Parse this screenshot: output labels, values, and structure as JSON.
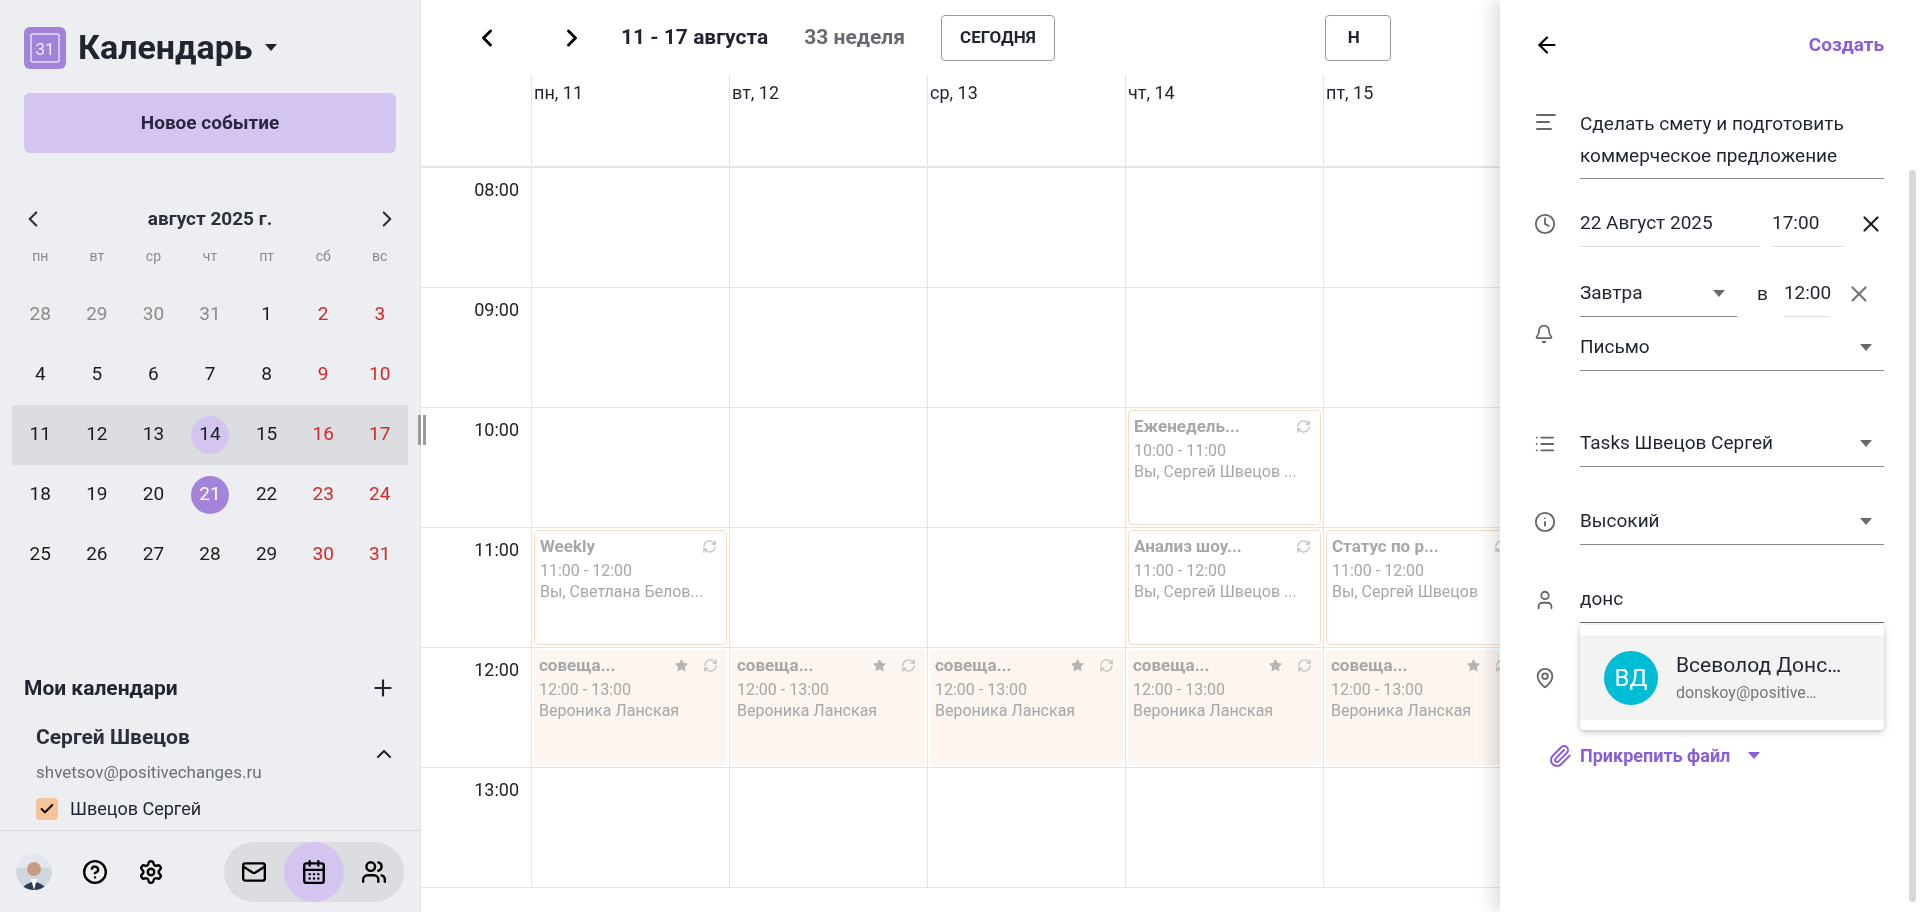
{
  "sidebar": {
    "logo_text": "31",
    "app_title": "Календарь",
    "new_event_button": "Новое событие",
    "mini_calendar": {
      "month": "август 2025 г.",
      "weekdays": [
        "пн",
        "вт",
        "ср",
        "чт",
        "пт",
        "сб",
        "вс"
      ],
      "weeks": [
        {
          "selected": false,
          "days": [
            {
              "label": "28",
              "kind": "outside",
              "today": false,
              "selected": false
            },
            {
              "label": "29",
              "kind": "outside",
              "today": false,
              "selected": false
            },
            {
              "label": "30",
              "kind": "outside",
              "today": false,
              "selected": false
            },
            {
              "label": "31",
              "kind": "outside",
              "today": false,
              "selected": false
            },
            {
              "label": "1",
              "kind": "weekday",
              "today": false,
              "selected": false
            },
            {
              "label": "2",
              "kind": "weekend",
              "today": false,
              "selected": false
            },
            {
              "label": "3",
              "kind": "weekend",
              "today": false,
              "selected": false
            }
          ]
        },
        {
          "selected": false,
          "days": [
            {
              "label": "4",
              "kind": "weekday",
              "today": false,
              "selected": false
            },
            {
              "label": "5",
              "kind": "weekday",
              "today": false,
              "selected": false
            },
            {
              "label": "6",
              "kind": "weekday",
              "today": false,
              "selected": false
            },
            {
              "label": "7",
              "kind": "weekday",
              "today": false,
              "selected": false
            },
            {
              "label": "8",
              "kind": "weekday",
              "today": false,
              "selected": false
            },
            {
              "label": "9",
              "kind": "weekend",
              "today": false,
              "selected": false
            },
            {
              "label": "10",
              "kind": "weekend",
              "today": false,
              "selected": false
            }
          ]
        },
        {
          "selected": true,
          "days": [
            {
              "label": "11",
              "kind": "weekday",
              "today": false,
              "selected": false
            },
            {
              "label": "12",
              "kind": "weekday",
              "today": false,
              "selected": false
            },
            {
              "label": "13",
              "kind": "weekday",
              "today": false,
              "selected": false
            },
            {
              "label": "14",
              "kind": "weekday",
              "today": true,
              "selected": false
            },
            {
              "label": "15",
              "kind": "weekday",
              "today": false,
              "selected": false
            },
            {
              "label": "16",
              "kind": "weekend",
              "today": false,
              "selected": false
            },
            {
              "label": "17",
              "kind": "weekend",
              "today": false,
              "selected": false
            }
          ]
        },
        {
          "selected": false,
          "days": [
            {
              "label": "18",
              "kind": "weekday",
              "today": false,
              "selected": false
            },
            {
              "label": "19",
              "kind": "weekday",
              "today": false,
              "selected": false
            },
            {
              "label": "20",
              "kind": "weekday",
              "today": false,
              "selected": false
            },
            {
              "label": "21",
              "kind": "weekday",
              "today": false,
              "selected": true
            },
            {
              "label": "22",
              "kind": "weekday",
              "today": false,
              "selected": false
            },
            {
              "label": "23",
              "kind": "weekend",
              "today": false,
              "selected": false
            },
            {
              "label": "24",
              "kind": "weekend",
              "today": false,
              "selected": false
            }
          ]
        },
        {
          "selected": false,
          "days": [
            {
              "label": "25",
              "kind": "weekday",
              "today": false,
              "selected": false
            },
            {
              "label": "26",
              "kind": "weekday",
              "today": false,
              "selected": false
            },
            {
              "label": "27",
              "kind": "weekday",
              "today": false,
              "selected": false
            },
            {
              "label": "28",
              "kind": "weekday",
              "today": false,
              "selected": false
            },
            {
              "label": "29",
              "kind": "weekday",
              "today": false,
              "selected": false
            },
            {
              "label": "30",
              "kind": "weekend",
              "today": false,
              "selected": false
            },
            {
              "label": "31",
              "kind": "weekend",
              "today": false,
              "selected": false
            }
          ]
        }
      ]
    },
    "my_calendars": {
      "heading": "Мои календари",
      "accounts": [
        {
          "name": "Сергей Швецов",
          "email": "shvetsov@positivechanges.ru",
          "expanded": true,
          "calendars": [
            {
              "label": "Швецов Сергей",
              "checked": true,
              "color": "#f6c39b"
            }
          ]
        }
      ]
    },
    "bottom_nav": [
      {
        "kind": "mail",
        "selected": false
      },
      {
        "kind": "calendar",
        "selected": true
      },
      {
        "kind": "contacts",
        "selected": false
      }
    ]
  },
  "week_view": {
    "range": "11 - 17 августа",
    "week_number": "33 неделя",
    "today_button": "СЕГОДНЯ",
    "view_button": "Н",
    "days": [
      "пн, 11",
      "вт, 12",
      "ср, 13",
      "чт, 14",
      "пт, 15"
    ],
    "hours": [
      {
        "time": "08:00",
        "cells": [
          {
            "kind": "empty"
          },
          {
            "kind": "empty"
          },
          {
            "kind": "empty"
          },
          {
            "kind": "empty"
          },
          {
            "kind": "empty"
          }
        ]
      },
      {
        "time": "09:00",
        "cells": [
          {
            "kind": "empty"
          },
          {
            "kind": "empty"
          },
          {
            "kind": "empty"
          },
          {
            "kind": "empty"
          },
          {
            "kind": "empty"
          }
        ]
      },
      {
        "time": "10:00",
        "cells": [
          {
            "kind": "empty"
          },
          {
            "kind": "empty"
          },
          {
            "kind": "empty"
          },
          {
            "kind": "outlined",
            "title": "Еженедель...",
            "time": "10:00 - 11:00",
            "people": "Вы, Сергей Швецов ...",
            "starred": false,
            "recurring": true
          },
          {
            "kind": "empty"
          }
        ]
      },
      {
        "time": "11:00",
        "cells": [
          {
            "kind": "outlined",
            "title": "Weekly",
            "time": "11:00 - 12:00",
            "people": "Вы, Светлана Белов...",
            "starred": false,
            "recurring": true
          },
          {
            "kind": "empty"
          },
          {
            "kind": "empty"
          },
          {
            "kind": "outlined",
            "title": "Анализ шоу...",
            "time": "11:00 - 12:00",
            "people": "Вы, Сергей Швецов ...",
            "starred": false,
            "recurring": true
          },
          {
            "kind": "outlined",
            "title": "Статус по р...",
            "time": "11:00 - 12:00",
            "people": "Вы, Сергей Швецов",
            "starred": false,
            "recurring": true
          }
        ]
      },
      {
        "time": "12:00",
        "cells": [
          {
            "kind": "filled",
            "title": "совеща...",
            "time": "12:00 - 13:00",
            "people": "Вероника Ланская",
            "starred": true,
            "recurring": true
          },
          {
            "kind": "filled",
            "title": "совеща...",
            "time": "12:00 - 13:00",
            "people": "Вероника Ланская",
            "starred": true,
            "recurring": true
          },
          {
            "kind": "filled",
            "title": "совеща...",
            "time": "12:00 - 13:00",
            "people": "Вероника Ланская",
            "starred": true,
            "recurring": true
          },
          {
            "kind": "filled",
            "title": "совеща...",
            "time": "12:00 - 13:00",
            "people": "Вероника Ланская",
            "starred": true,
            "recurring": true
          },
          {
            "kind": "filled",
            "title": "совеща...",
            "time": "12:00 - 13:00",
            "people": "Вероника Ланская",
            "starred": true,
            "recurring": true
          }
        ]
      },
      {
        "time": "13:00",
        "cells": [
          {
            "kind": "empty"
          },
          {
            "kind": "empty"
          },
          {
            "kind": "empty"
          },
          {
            "kind": "empty"
          },
          {
            "kind": "empty"
          }
        ]
      }
    ]
  },
  "task_panel": {
    "create_link": "Создать",
    "title": "Сделать смету и подготовить коммерческое предложение",
    "date": "22 Август 2025",
    "time": "17:00",
    "reminder": {
      "when": "Завтра",
      "at_label": "в",
      "time": "12:00",
      "method": "Письмо"
    },
    "list": "Tasks Швецов Сергей",
    "priority": "Высокий",
    "assignee_query": "донс",
    "suggestions": [
      {
        "initials": "ВД",
        "name": "Всеволод Донс…",
        "email": "donskoy@positive…",
        "color": "#00bcd4"
      }
    ],
    "attach_link": "Прикрепить файл"
  }
}
